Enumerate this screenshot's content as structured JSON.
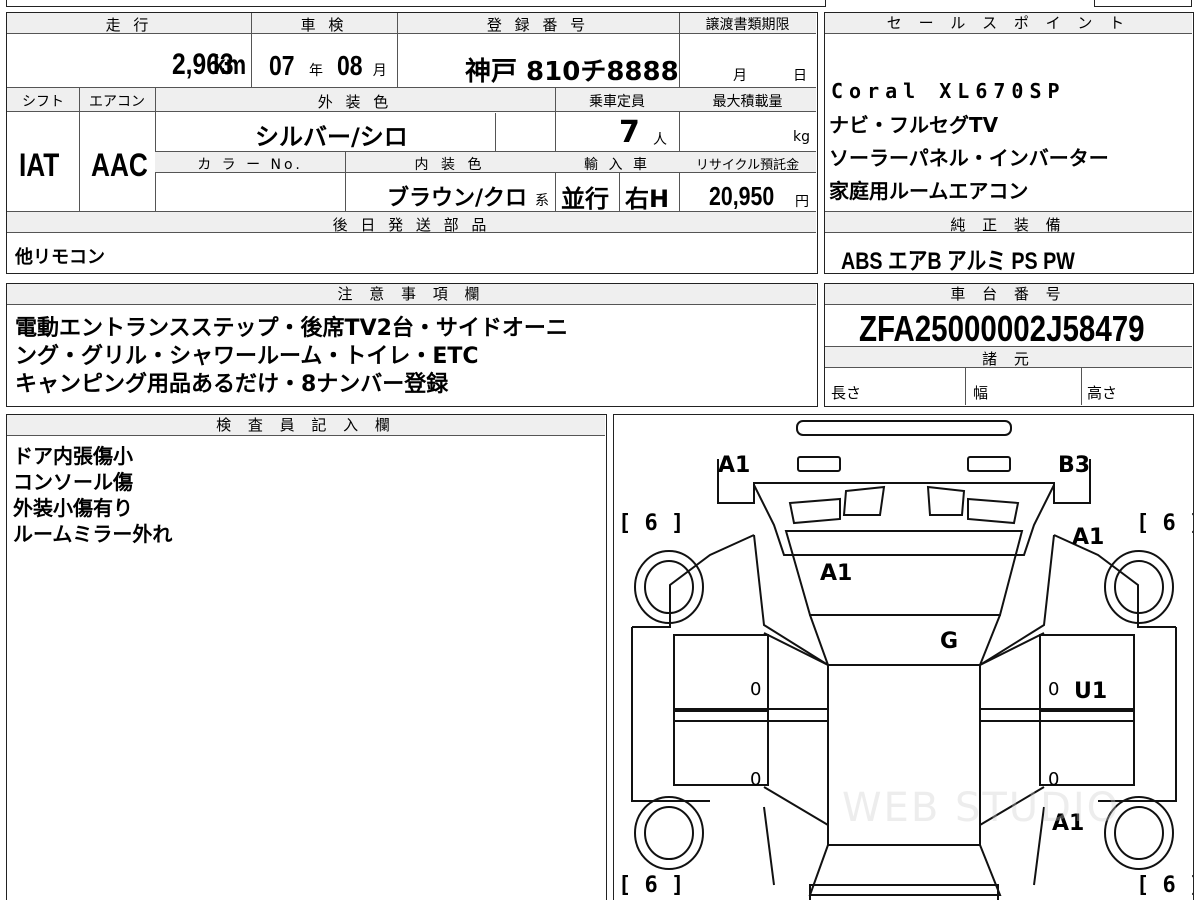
{
  "top": {
    "mileage_label": "走 行",
    "shaken_label": "車 検",
    "reg_label": "登 録 番 号",
    "transfer_label": "譲渡書類期限",
    "mileage": "2,963",
    "mileage_unit": "km",
    "shaken_year": "07",
    "year_unit": "年",
    "shaken_month": "08",
    "month_unit": "月",
    "registration": "神戸 810チ8888",
    "transfer_month": "月",
    "transfer_day": "日",
    "shift_label": "シフト",
    "ac_label": "エアコン",
    "exterior_color_label": "外 装 色",
    "capacity_label": "乗車定員",
    "max_load_label": "最大積載量",
    "exterior_color": "シルバー/シロ",
    "capacity": "7",
    "capacity_unit": "人",
    "load_unit": "kg",
    "shift": "IAT",
    "ac": "AAC",
    "color_no_label": "カ ラ ー No.",
    "interior_color_label": "内 装 色",
    "import_label": "輸 入 車",
    "recycle_label": "リサイクル預託金",
    "interior_color": "ブラウン/クロ",
    "interior_suffix": "系",
    "import_type": "並行",
    "steering": "右H",
    "recycle_fee": "20,950",
    "yen_unit": "円",
    "parts_label": "後 日 発 送 部 品",
    "parts": "他リモコン"
  },
  "sales_points": {
    "label": "セ ー ル ス ポ イ ン ト",
    "lines": [
      "Coral XL670SP",
      "ナビ・フルセグTV",
      "ソーラーパネル・インバーター",
      "家庭用ルームエアコン"
    ]
  },
  "equipment": {
    "label": "純 正 装 備",
    "items": "ABS エアB アルミ PS PW"
  },
  "notes": {
    "label": "注 意 事 項 欄",
    "lines": [
      "電動エントランスステップ・後席TV2台・サイドオーニ",
      "ング・グリル・シャワールーム・トイレ・ETC",
      "キャンピング用品あるだけ・8ナンバー登録"
    ]
  },
  "chassis": {
    "label": "車 台 番 号",
    "number": "ZFA25000002J58479",
    "specs_label": "諸 元",
    "length_label": "長さ",
    "width_label": "幅",
    "height_label": "高さ"
  },
  "inspector": {
    "label": "検 査 員 記 入 欄",
    "lines": [
      "ドア内張傷小",
      "コンソール傷",
      "外装小傷有り",
      "ルームミラー外れ"
    ]
  },
  "diagram": {
    "bracket_label": "[ 6 ]",
    "marks": {
      "front_left": "A1",
      "front_right": "B3",
      "right_front_fender": "A1",
      "windshield": "A1",
      "roof": "G",
      "right_door": "U1",
      "right_rear": "A1",
      "left_front_door_zero": "0",
      "left_rear_door_zero": "0",
      "right_front_door_zero": "0",
      "right_rear_door_zero": "0"
    },
    "watermark": "WEB STUDIO"
  }
}
